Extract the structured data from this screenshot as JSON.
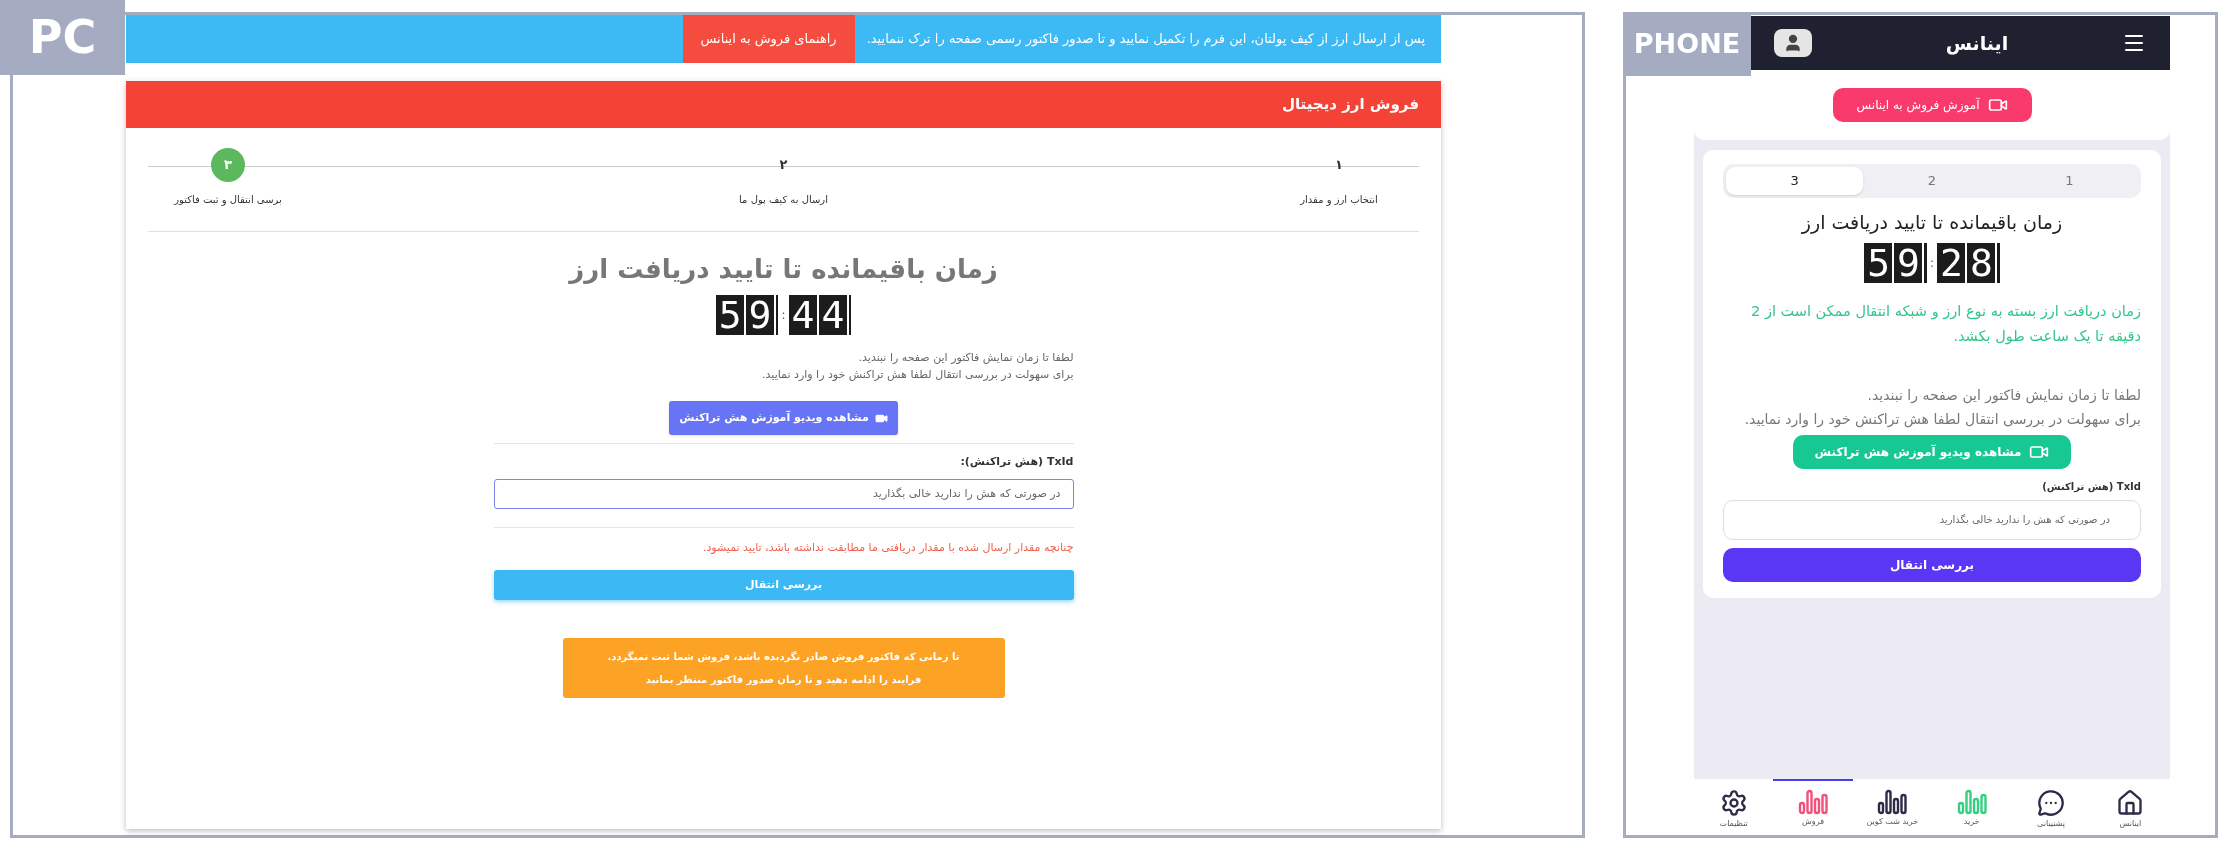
{
  "pc": {
    "label": "PC",
    "banner": {
      "text": "پس از ارسال ارز از کیف پولتان، این فرم را تکمیل نمایید و تا صدور فاکتور رسمی صفحه را ترک ننمایید.",
      "button": "راهنمای فروش به اینانس"
    },
    "card": {
      "title": "فروش ارز دیجیتال",
      "steps": [
        {
          "number": "۱",
          "label": "انتخاب ارز و مقدار",
          "selected": false
        },
        {
          "number": "۲",
          "label": "ارسال به کیف پول ما",
          "selected": false
        },
        {
          "number": "۳",
          "label": "برسی انتقال و ثبت فاکتور",
          "selected": true
        }
      ],
      "countdown": {
        "title": "زمان باقیمانده تا تایید دریافت ارز",
        "minutes": "59",
        "separator": ":",
        "seconds": "44"
      },
      "notes": [
        "لطفا تا زمان نمایش فاکتور این صفحه را نبندید.",
        "برای سهولت در بررسی انتقال لطفا هش تراکنش خود را وارد نمایید."
      ],
      "video_button": "مشاهده ویدیو آموزش هش تراکنش",
      "txid": {
        "label": "TxId (هش تراکنش):",
        "placeholder": "در صورتی که هش را ندارید خالی بگذارید"
      },
      "warning": "چنانچه مقدار ارسال شده با مقدار دریافتی ما مطابقت نداشته باشد، تایید نمیشود.",
      "submit": "بررسی انتقال",
      "notice": [
        "تا زمانی که فاکتور فروش صادر نگردیده باشد، فروش شما ثبت نمیگردد.",
        "فرایند را ادامه دهید و تا زمان صدور فاکتور منتظر بمانید"
      ]
    }
  },
  "phone": {
    "label": "PHONE",
    "app_title": "اینانس",
    "tutorial_button": "آموزش فروش به اینانس",
    "tabs": [
      {
        "label": "1",
        "selected": false
      },
      {
        "label": "2",
        "selected": false
      },
      {
        "label": "3",
        "selected": true
      }
    ],
    "countdown": {
      "title": "زمان باقیمانده تا تایید دریافت ارز",
      "minutes": "59",
      "separator": ":",
      "seconds": "28"
    },
    "info": "زمان دریافت ارز بسته به نوع ارز و شبکه انتقال ممکن است از 2 دقیقه تا یک ساعت طول بکشد.",
    "notes": [
      "لطفا تا زمان نمایش فاکتور این صفحه را نبندید.",
      "برای سهولت در بررسی انتقال لطفا هش تراکنش خود را وارد نمایید."
    ],
    "video_button": "مشاهده ویدیو آموزش هش تراکنش",
    "txid": {
      "label": "TxId (هش تراکنش)",
      "placeholder": "در صورتی که هش را ندارید خالی بگذارید"
    },
    "submit": "بررسی انتقال",
    "nav": [
      {
        "label": "اینانس",
        "kind": "home",
        "color": "#2d2b45",
        "selected": false
      },
      {
        "label": "پشتیبانی",
        "kind": "chat",
        "color": "#2d2b45",
        "selected": false
      },
      {
        "label": "خرید",
        "kind": "bars",
        "color": "#34d07f",
        "selected": false
      },
      {
        "label": "خرید شت کوین",
        "kind": "bars",
        "color": "#2d2b45",
        "selected": false
      },
      {
        "label": "فروش",
        "kind": "bars",
        "color": "#f2517a",
        "selected": true
      },
      {
        "label": "تنظیمات",
        "kind": "gear",
        "color": "#2d2b45",
        "selected": false
      }
    ]
  }
}
